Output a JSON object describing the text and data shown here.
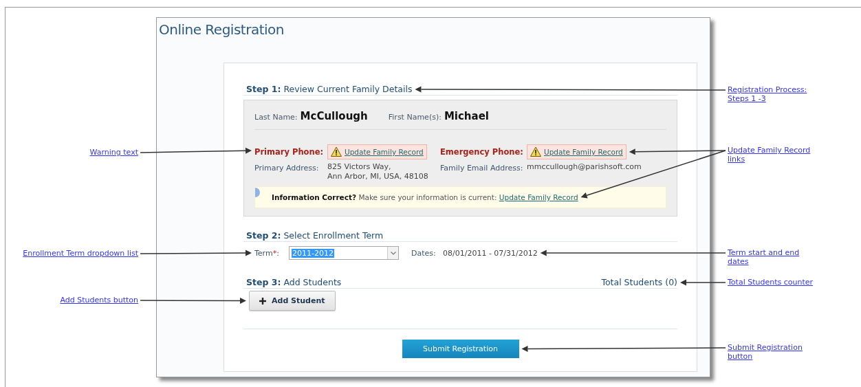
{
  "page": {
    "title": "Online Registration"
  },
  "step1": {
    "number": "Step 1:",
    "title": "Review Current Family Details"
  },
  "family": {
    "last_name_label": "Last Name:",
    "last_name": "McCullough",
    "first_name_label": "First Name(s):",
    "first_name": "Michael",
    "fields": [
      {
        "label": "Primary Phone:",
        "warning": true,
        "link": "Update Family Record"
      },
      {
        "label": "Emergency Phone:",
        "warning": true,
        "link": "Update Family Record"
      },
      {
        "label": "Primary Address:",
        "warning": false,
        "value_lines": [
          "825 Victors Way,",
          "Ann Arbor, MI, USA, 48108"
        ]
      },
      {
        "label": "Family Email Address:",
        "warning": false,
        "value_lines": [
          "mmccullough@parishsoft.com"
        ]
      }
    ],
    "info": {
      "title": "Information Correct?",
      "text": "Make sure your information is current:",
      "link": "Update Family Record"
    }
  },
  "step2": {
    "number": "Step 2:",
    "title": "Select Enrollment Term"
  },
  "term": {
    "label": "Term",
    "required_mark": "*",
    "label_end": ":",
    "value": "2011-2012",
    "dates_label": "Dates:",
    "dates": "08/01/2011 - 07/31/2012"
  },
  "step3": {
    "number": "Step 3:",
    "title": "Add Students",
    "total": "Total Students (0)",
    "add_button": "Add Student"
  },
  "submit_button": "Submit Registration",
  "left_callouts": [
    {
      "text": "Warning text"
    },
    {
      "text": "Enrollment Term dropdown list"
    },
    {
      "text": "Add Students button"
    }
  ],
  "right_callouts": [
    {
      "text": "Registration Process: Steps 1 -3"
    },
    {
      "text": "Update Family Record links"
    },
    {
      "text": "Term start and end dates"
    },
    {
      "text": "Total Students counter"
    },
    {
      "text": "Submit Registration button"
    }
  ]
}
